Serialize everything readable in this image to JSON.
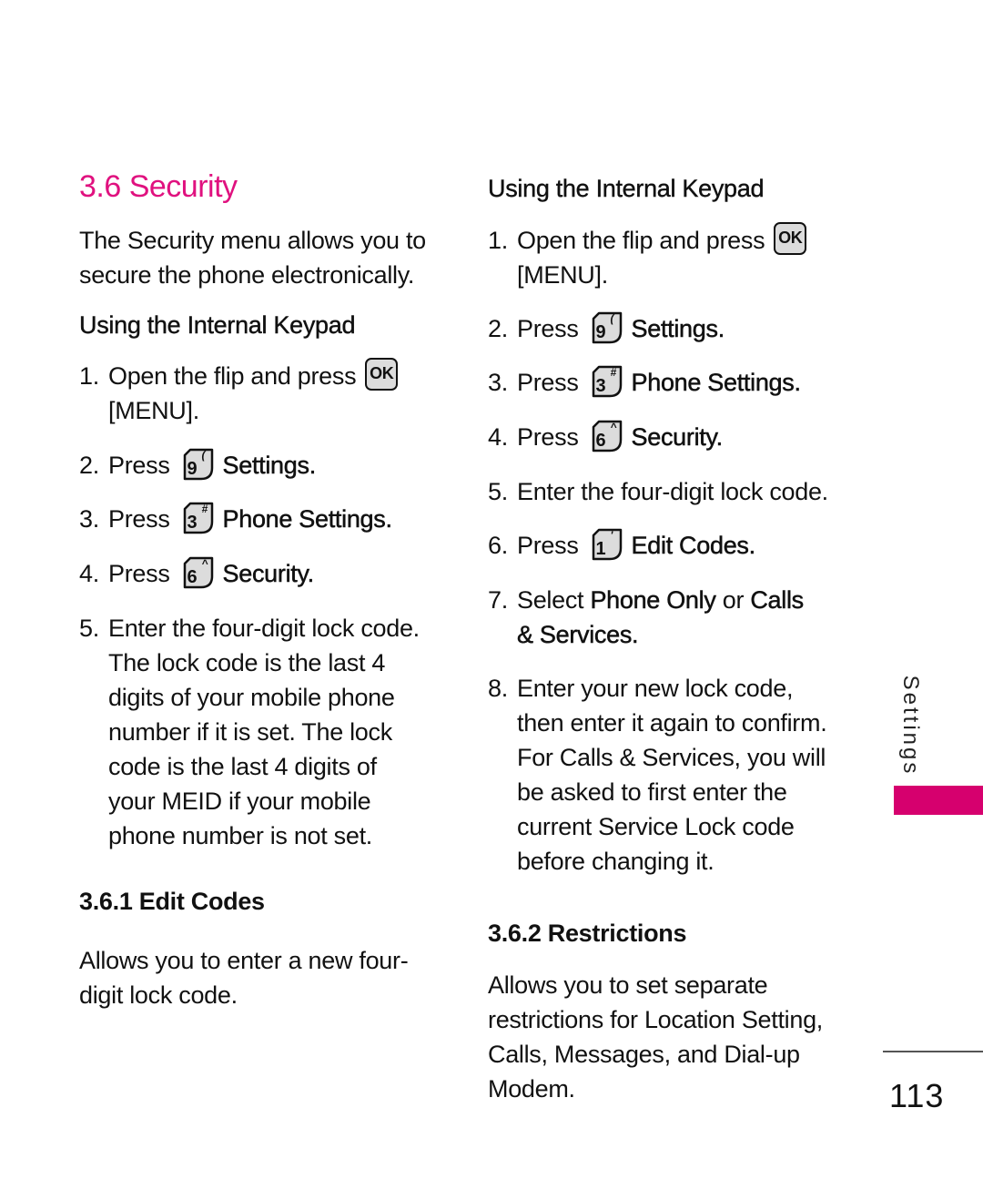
{
  "page": {
    "section_title": "3.6 Security",
    "side_tab_label": "Settings",
    "page_number": "113",
    "accent_color": "#E0117F"
  },
  "left": {
    "intro_line1": "The Security menu allows you to",
    "intro_line2": "secure the phone electronically.",
    "subheading": "Using the Internal Keypad",
    "steps": [
      {
        "num": "1.",
        "text": "Open the flip and press",
        "key": "OK",
        "cont": "[MENU]."
      },
      {
        "num": "2.",
        "text": "Press",
        "key": "9",
        "key_sym": "(",
        "label": "Settings."
      },
      {
        "num": "3.",
        "text": "Press",
        "key": "3",
        "key_sym": "#",
        "label": "Phone Settings."
      },
      {
        "num": "4.",
        "text": "Press",
        "key": "6",
        "key_sym": "^",
        "label": "Security."
      },
      {
        "num": "5.",
        "lines": [
          "Enter the four-digit lock code.",
          "The lock code is the last 4",
          "digits of your mobile phone",
          "number if it is set. The lock",
          "code is the last 4 digits of",
          "your MEID if your mobile",
          "phone number is not set."
        ]
      }
    ],
    "edit_codes": {
      "heading": "3.6.1 Edit Codes",
      "line1": "Allows you to enter a new four-",
      "line2": "digit lock code."
    }
  },
  "right": {
    "subheading": "Using the Internal Keypad",
    "steps": [
      {
        "num": "1.",
        "text": "Open the flip and press",
        "key": "OK",
        "cont": "[MENU]."
      },
      {
        "num": "2.",
        "text": "Press",
        "key": "9",
        "key_sym": "(",
        "label": "Settings."
      },
      {
        "num": "3.",
        "text": "Press",
        "key": "3",
        "key_sym": "#",
        "label": "Phone Settings."
      },
      {
        "num": "4.",
        "text": "Press",
        "key": "6",
        "key_sym": "^",
        "label": "Security."
      },
      {
        "num": "5.",
        "text": "Enter the four-digit lock code."
      },
      {
        "num": "6.",
        "text": "Press",
        "key": "1",
        "key_sym": "'",
        "label": "Edit Codes."
      },
      {
        "num": "7.",
        "pre": "Select ",
        "opt1": "Phone Only",
        "mid": " or ",
        "opt2": "Calls",
        "cont": "& Services."
      },
      {
        "num": "8.",
        "lines": [
          "Enter your new lock code,",
          "then enter it again to confirm.",
          "For Calls & Services, you will",
          "be asked to first enter the",
          "current Service Lock code",
          "before changing it."
        ]
      }
    ],
    "restrictions": {
      "heading": "3.6.2 Restrictions",
      "lines": [
        "Allows you to set separate",
        "restrictions for Location Setting,",
        "Calls, Messages, and Dial-up",
        "Modem."
      ]
    }
  }
}
